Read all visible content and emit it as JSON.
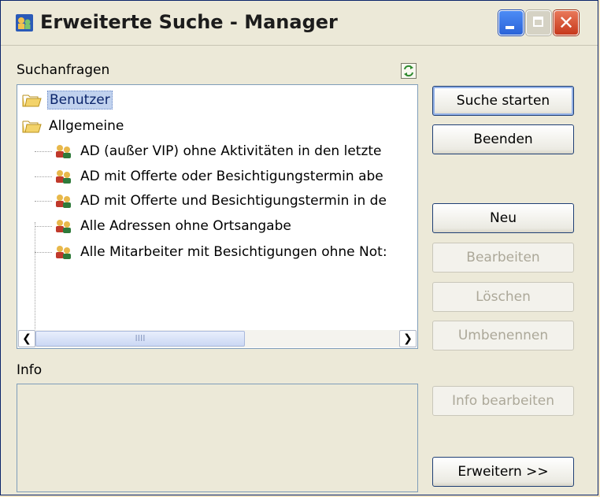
{
  "window": {
    "title": "Erweiterte Suche - Manager",
    "controls": {
      "minimize_icon": "minimize-icon",
      "maximize_icon": "maximize-icon",
      "close_glyph": "✕"
    }
  },
  "queries_panel": {
    "label": "Suchanfragen",
    "refresh_icon": "refresh-icon",
    "tree": {
      "folders": [
        {
          "label": "Benutzer",
          "icon": "folder-open-icon",
          "selected": true
        },
        {
          "label": "Allgemeine",
          "icon": "folder-open-icon",
          "selected": false
        }
      ],
      "items": [
        {
          "label": "AD (außer VIP) ohne Aktivitäten in den letzte",
          "icon": "users-group-icon"
        },
        {
          "label": "AD mit Offerte oder Besichtigungstermin abe",
          "icon": "users-group-icon"
        },
        {
          "label": "AD mit Offerte und Besichtigungstermin in de",
          "icon": "users-group-icon"
        },
        {
          "label": "Alle Adressen ohne Ortsangabe",
          "icon": "users-group-icon"
        },
        {
          "label": "Alle Mitarbeiter mit Besichtigungen ohne Not:",
          "icon": "users-group-icon"
        }
      ]
    },
    "scrollbar": {
      "left_glyph": "❮",
      "right_glyph": "❯",
      "thumb_grip": "IIII"
    }
  },
  "info_panel": {
    "label": "Info",
    "text": ""
  },
  "buttons": {
    "start_search": "Suche starten",
    "exit": "Beenden",
    "new": "Neu",
    "edit": "Bearbeiten",
    "delete": "Löschen",
    "rename": "Umbenennen",
    "edit_info": "Info bearbeiten",
    "expand": "Erweitern  >>"
  },
  "colors": {
    "selection": "#c1d2ee",
    "window_bg": "#ece9d8",
    "border": "#7f9db9"
  }
}
